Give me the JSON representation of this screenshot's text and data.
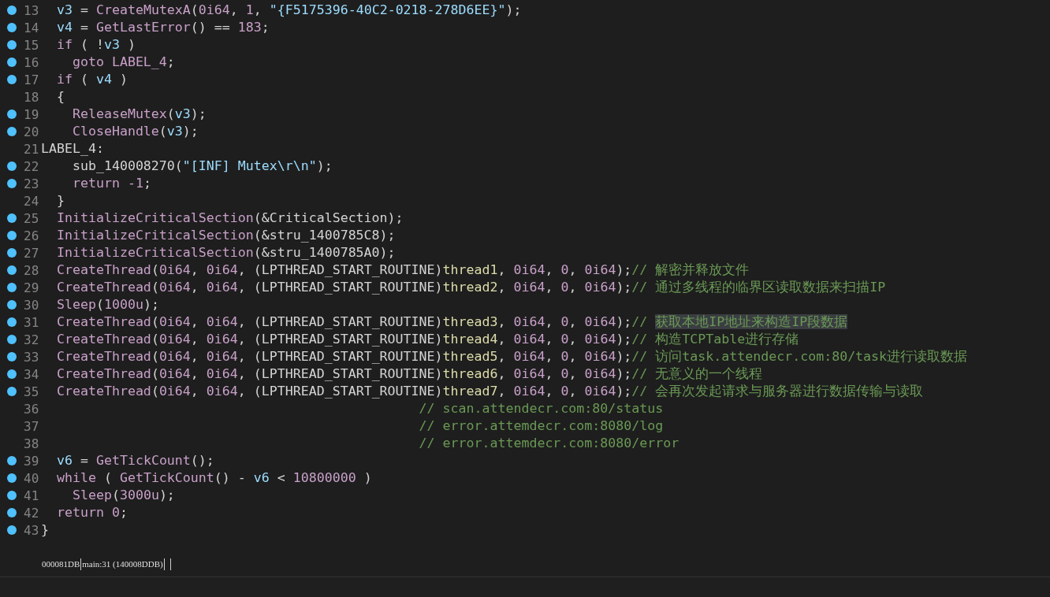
{
  "lines": [
    {
      "number": "13",
      "breakpoint": true,
      "tokens": [
        {
          "kind": "var",
          "text": "  v3"
        },
        {
          "kind": "plain",
          "text": " = "
        },
        {
          "kind": "func",
          "text": "CreateMutexA"
        },
        {
          "kind": "plain",
          "text": "("
        },
        {
          "kind": "number",
          "text": "0i64"
        },
        {
          "kind": "plain",
          "text": ", "
        },
        {
          "kind": "number",
          "text": "1"
        },
        {
          "kind": "plain",
          "text": ", "
        },
        {
          "kind": "string",
          "text": "\"{F5175396-40C2-0218-278D6EE}\""
        },
        {
          "kind": "plain",
          "text": ");"
        }
      ]
    },
    {
      "number": "14",
      "breakpoint": true,
      "tokens": [
        {
          "kind": "var",
          "text": "  v4"
        },
        {
          "kind": "plain",
          "text": " = "
        },
        {
          "kind": "func",
          "text": "GetLastError"
        },
        {
          "kind": "plain",
          "text": "() == "
        },
        {
          "kind": "number",
          "text": "183"
        },
        {
          "kind": "plain",
          "text": ";"
        }
      ]
    },
    {
      "number": "15",
      "breakpoint": true,
      "tokens": [
        {
          "kind": "keyword",
          "text": "  if"
        },
        {
          "kind": "plain",
          "text": " ( !"
        },
        {
          "kind": "var",
          "text": "v3"
        },
        {
          "kind": "plain",
          "text": " )"
        }
      ]
    },
    {
      "number": "16",
      "breakpoint": true,
      "tokens": [
        {
          "kind": "keyword",
          "text": "    goto LABEL_4"
        },
        {
          "kind": "plain",
          "text": ";"
        }
      ]
    },
    {
      "number": "17",
      "breakpoint": true,
      "tokens": [
        {
          "kind": "keyword",
          "text": "  if"
        },
        {
          "kind": "plain",
          "text": " ( "
        },
        {
          "kind": "var",
          "text": "v4"
        },
        {
          "kind": "plain",
          "text": " )"
        }
      ]
    },
    {
      "number": "18",
      "breakpoint": false,
      "tokens": [
        {
          "kind": "plain",
          "text": "  {"
        }
      ]
    },
    {
      "number": "19",
      "breakpoint": true,
      "tokens": [
        {
          "kind": "func",
          "text": "    ReleaseMutex"
        },
        {
          "kind": "plain",
          "text": "("
        },
        {
          "kind": "var",
          "text": "v3"
        },
        {
          "kind": "plain",
          "text": ");"
        }
      ]
    },
    {
      "number": "20",
      "breakpoint": true,
      "tokens": [
        {
          "kind": "func",
          "text": "    CloseHandle"
        },
        {
          "kind": "plain",
          "text": "("
        },
        {
          "kind": "var",
          "text": "v3"
        },
        {
          "kind": "plain",
          "text": ");"
        }
      ]
    },
    {
      "number": "21",
      "breakpoint": false,
      "tokens": [
        {
          "kind": "plain",
          "text": "LABEL_4:"
        }
      ]
    },
    {
      "number": "22",
      "breakpoint": true,
      "tokens": [
        {
          "kind": "plain",
          "text": "    sub_140008270("
        },
        {
          "kind": "string",
          "text": "\"[INF] Mutex\\r\\n\""
        },
        {
          "kind": "plain",
          "text": ");"
        }
      ]
    },
    {
      "number": "23",
      "breakpoint": true,
      "tokens": [
        {
          "kind": "keyword",
          "text": "    return -1"
        },
        {
          "kind": "plain",
          "text": ";"
        }
      ]
    },
    {
      "number": "24",
      "breakpoint": false,
      "tokens": [
        {
          "kind": "plain",
          "text": "  }"
        }
      ]
    },
    {
      "number": "25",
      "breakpoint": true,
      "tokens": [
        {
          "kind": "func",
          "text": "  InitializeCriticalSection"
        },
        {
          "kind": "plain",
          "text": "(&CriticalSection);"
        }
      ]
    },
    {
      "number": "26",
      "breakpoint": true,
      "tokens": [
        {
          "kind": "func",
          "text": "  InitializeCriticalSection"
        },
        {
          "kind": "plain",
          "text": "(&stru_1400785C8);"
        }
      ]
    },
    {
      "number": "27",
      "breakpoint": true,
      "tokens": [
        {
          "kind": "func",
          "text": "  InitializeCriticalSection"
        },
        {
          "kind": "plain",
          "text": "(&stru_1400785A0);"
        }
      ]
    },
    {
      "number": "28",
      "breakpoint": true,
      "tokens": [
        {
          "kind": "func",
          "text": "  CreateThread"
        },
        {
          "kind": "plain",
          "text": "("
        },
        {
          "kind": "number",
          "text": "0i64"
        },
        {
          "kind": "plain",
          "text": ", "
        },
        {
          "kind": "number",
          "text": "0i64"
        },
        {
          "kind": "plain",
          "text": ", (LPTHREAD_START_ROUTINE)"
        },
        {
          "kind": "name",
          "text": "thread1"
        },
        {
          "kind": "plain",
          "text": ", "
        },
        {
          "kind": "number",
          "text": "0i64"
        },
        {
          "kind": "plain",
          "text": ", "
        },
        {
          "kind": "number",
          "text": "0"
        },
        {
          "kind": "plain",
          "text": ", "
        },
        {
          "kind": "number",
          "text": "0i64"
        },
        {
          "kind": "plain",
          "text": ");"
        },
        {
          "kind": "comment",
          "text": "// 解密并释放文件"
        }
      ]
    },
    {
      "number": "29",
      "breakpoint": true,
      "tokens": [
        {
          "kind": "func",
          "text": "  CreateThread"
        },
        {
          "kind": "plain",
          "text": "("
        },
        {
          "kind": "number",
          "text": "0i64"
        },
        {
          "kind": "plain",
          "text": ", "
        },
        {
          "kind": "number",
          "text": "0i64"
        },
        {
          "kind": "plain",
          "text": ", (LPTHREAD_START_ROUTINE)"
        },
        {
          "kind": "name",
          "text": "thread2"
        },
        {
          "kind": "plain",
          "text": ", "
        },
        {
          "kind": "number",
          "text": "0i64"
        },
        {
          "kind": "plain",
          "text": ", "
        },
        {
          "kind": "number",
          "text": "0"
        },
        {
          "kind": "plain",
          "text": ", "
        },
        {
          "kind": "number",
          "text": "0i64"
        },
        {
          "kind": "plain",
          "text": ");"
        },
        {
          "kind": "comment",
          "text": "// 通过多线程的临界区读取数据来扫描IP"
        }
      ]
    },
    {
      "number": "30",
      "breakpoint": true,
      "tokens": [
        {
          "kind": "func",
          "text": "  Sleep"
        },
        {
          "kind": "plain",
          "text": "("
        },
        {
          "kind": "number",
          "text": "1000u"
        },
        {
          "kind": "plain",
          "text": ");"
        }
      ]
    },
    {
      "number": "31",
      "breakpoint": true,
      "tokens": [
        {
          "kind": "func",
          "text": "  CreateThread"
        },
        {
          "kind": "plain",
          "text": "("
        },
        {
          "kind": "number",
          "text": "0i64"
        },
        {
          "kind": "plain",
          "text": ", "
        },
        {
          "kind": "number",
          "text": "0i64"
        },
        {
          "kind": "plain",
          "text": ", (LPTHREAD_START_ROUTINE)"
        },
        {
          "kind": "name",
          "text": "thread3"
        },
        {
          "kind": "plain",
          "text": ", "
        },
        {
          "kind": "number",
          "text": "0i64"
        },
        {
          "kind": "plain",
          "text": ", "
        },
        {
          "kind": "number",
          "text": "0"
        },
        {
          "kind": "plain",
          "text": ", "
        },
        {
          "kind": "number",
          "text": "0i64"
        },
        {
          "kind": "plain",
          "text": ");"
        },
        {
          "kind": "comment",
          "text": "// "
        },
        {
          "kind": "selection",
          "text": "获取本地IP地址来构造IP段数据"
        }
      ]
    },
    {
      "number": "32",
      "breakpoint": true,
      "tokens": [
        {
          "kind": "func",
          "text": "  CreateThread"
        },
        {
          "kind": "plain",
          "text": "("
        },
        {
          "kind": "number",
          "text": "0i64"
        },
        {
          "kind": "plain",
          "text": ", "
        },
        {
          "kind": "number",
          "text": "0i64"
        },
        {
          "kind": "plain",
          "text": ", (LPTHREAD_START_ROUTINE)"
        },
        {
          "kind": "name",
          "text": "thread4"
        },
        {
          "kind": "plain",
          "text": ", "
        },
        {
          "kind": "number",
          "text": "0i64"
        },
        {
          "kind": "plain",
          "text": ", "
        },
        {
          "kind": "number",
          "text": "0"
        },
        {
          "kind": "plain",
          "text": ", "
        },
        {
          "kind": "number",
          "text": "0i64"
        },
        {
          "kind": "plain",
          "text": ");"
        },
        {
          "kind": "comment",
          "text": "// 构造TCPTable进行存储"
        }
      ]
    },
    {
      "number": "33",
      "breakpoint": true,
      "tokens": [
        {
          "kind": "func",
          "text": "  CreateThread"
        },
        {
          "kind": "plain",
          "text": "("
        },
        {
          "kind": "number",
          "text": "0i64"
        },
        {
          "kind": "plain",
          "text": ", "
        },
        {
          "kind": "number",
          "text": "0i64"
        },
        {
          "kind": "plain",
          "text": ", (LPTHREAD_START_ROUTINE)"
        },
        {
          "kind": "name",
          "text": "thread5"
        },
        {
          "kind": "plain",
          "text": ", "
        },
        {
          "kind": "number",
          "text": "0i64"
        },
        {
          "kind": "plain",
          "text": ", "
        },
        {
          "kind": "number",
          "text": "0"
        },
        {
          "kind": "plain",
          "text": ", "
        },
        {
          "kind": "number",
          "text": "0i64"
        },
        {
          "kind": "plain",
          "text": ");"
        },
        {
          "kind": "comment",
          "text": "// 访问task.attendecr.com:80/task进行读取数据"
        }
      ]
    },
    {
      "number": "34",
      "breakpoint": true,
      "tokens": [
        {
          "kind": "func",
          "text": "  CreateThread"
        },
        {
          "kind": "plain",
          "text": "("
        },
        {
          "kind": "number",
          "text": "0i64"
        },
        {
          "kind": "plain",
          "text": ", "
        },
        {
          "kind": "number",
          "text": "0i64"
        },
        {
          "kind": "plain",
          "text": ", (LPTHREAD_START_ROUTINE)"
        },
        {
          "kind": "name",
          "text": "thread6"
        },
        {
          "kind": "plain",
          "text": ", "
        },
        {
          "kind": "number",
          "text": "0i64"
        },
        {
          "kind": "plain",
          "text": ", "
        },
        {
          "kind": "number",
          "text": "0"
        },
        {
          "kind": "plain",
          "text": ", "
        },
        {
          "kind": "number",
          "text": "0i64"
        },
        {
          "kind": "plain",
          "text": ");"
        },
        {
          "kind": "comment",
          "text": "// 无意义的一个线程"
        }
      ]
    },
    {
      "number": "35",
      "breakpoint": true,
      "tokens": [
        {
          "kind": "func",
          "text": "  CreateThread"
        },
        {
          "kind": "plain",
          "text": "("
        },
        {
          "kind": "number",
          "text": "0i64"
        },
        {
          "kind": "plain",
          "text": ", "
        },
        {
          "kind": "number",
          "text": "0i64"
        },
        {
          "kind": "plain",
          "text": ", (LPTHREAD_START_ROUTINE)"
        },
        {
          "kind": "name",
          "text": "thread7"
        },
        {
          "kind": "plain",
          "text": ", "
        },
        {
          "kind": "number",
          "text": "0i64"
        },
        {
          "kind": "plain",
          "text": ", "
        },
        {
          "kind": "number",
          "text": "0"
        },
        {
          "kind": "plain",
          "text": ", "
        },
        {
          "kind": "number",
          "text": "0i64"
        },
        {
          "kind": "plain",
          "text": ");"
        },
        {
          "kind": "comment",
          "text": "// 会再次发起请求与服务器进行数据传输与读取"
        }
      ]
    },
    {
      "number": "36",
      "breakpoint": false,
      "tokens": [
        {
          "kind": "comment",
          "text": "                                                // scan.attendecr.com:80/status"
        }
      ]
    },
    {
      "number": "37",
      "breakpoint": false,
      "tokens": [
        {
          "kind": "comment",
          "text": "                                                // error.attemdecr.com:8080/log"
        }
      ]
    },
    {
      "number": "38",
      "breakpoint": false,
      "tokens": [
        {
          "kind": "comment",
          "text": "                                                // error.attemdecr.com:8080/error"
        }
      ]
    },
    {
      "number": "39",
      "breakpoint": true,
      "tokens": [
        {
          "kind": "var",
          "text": "  v6"
        },
        {
          "kind": "plain",
          "text": " = "
        },
        {
          "kind": "func",
          "text": "GetTickCount"
        },
        {
          "kind": "plain",
          "text": "();"
        }
      ]
    },
    {
      "number": "40",
      "breakpoint": true,
      "tokens": [
        {
          "kind": "keyword",
          "text": "  while"
        },
        {
          "kind": "plain",
          "text": " ( "
        },
        {
          "kind": "func",
          "text": "GetTickCount"
        },
        {
          "kind": "plain",
          "text": "() - "
        },
        {
          "kind": "var",
          "text": "v6"
        },
        {
          "kind": "plain",
          "text": " < "
        },
        {
          "kind": "number",
          "text": "10800000"
        },
        {
          "kind": "plain",
          "text": " )"
        }
      ]
    },
    {
      "number": "41",
      "breakpoint": true,
      "tokens": [
        {
          "kind": "func",
          "text": "    Sleep"
        },
        {
          "kind": "plain",
          "text": "("
        },
        {
          "kind": "number",
          "text": "3000u"
        },
        {
          "kind": "plain",
          "text": ");"
        }
      ]
    },
    {
      "number": "42",
      "breakpoint": true,
      "tokens": [
        {
          "kind": "keyword",
          "text": "  return"
        },
        {
          "kind": "number",
          "text": " 0"
        },
        {
          "kind": "plain",
          "text": ";"
        }
      ]
    },
    {
      "number": "43",
      "breakpoint": true,
      "tokens": [
        {
          "kind": "plain",
          "text": "}"
        }
      ]
    }
  ],
  "status_bar": {
    "address": "000081DB",
    "location": "main:31 (140008DDB)"
  }
}
